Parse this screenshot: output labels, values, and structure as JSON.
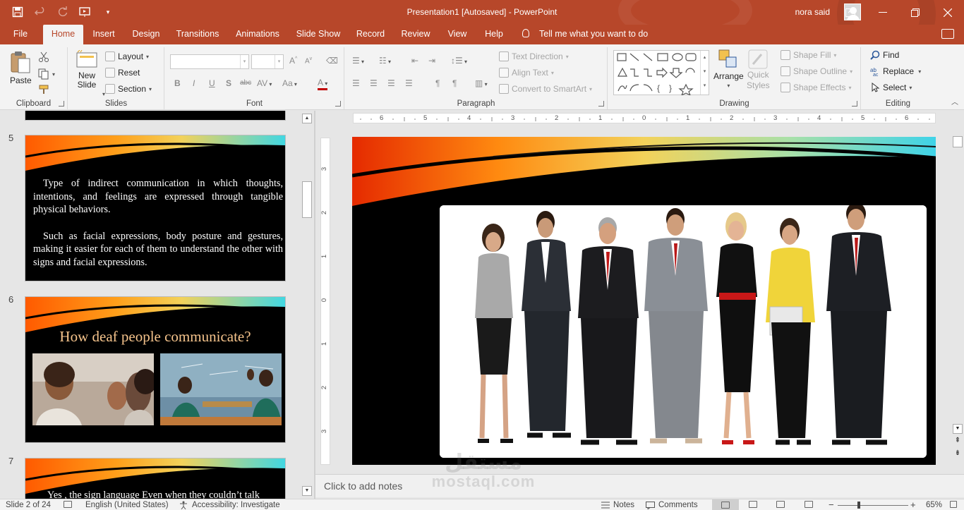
{
  "app": {
    "document_title": "Presentation1 [Autosaved]  -  PowerPoint",
    "user_name": "nora said"
  },
  "quick_access": {
    "icons": [
      "save-icon",
      "undo-icon",
      "redo-icon",
      "present-from-start-icon",
      "customize-icon"
    ]
  },
  "tabs": [
    {
      "label": "File"
    },
    {
      "label": "Home"
    },
    {
      "label": "Insert"
    },
    {
      "label": "Design"
    },
    {
      "label": "Transitions"
    },
    {
      "label": "Animations"
    },
    {
      "label": "Slide Show"
    },
    {
      "label": "Record"
    },
    {
      "label": "Review"
    },
    {
      "label": "View"
    },
    {
      "label": "Help"
    }
  ],
  "active_tab": "Home",
  "tell_me": "Tell me what you want to do",
  "ribbon": {
    "clipboard": {
      "label": "Clipboard",
      "paste": "Paste"
    },
    "slides": {
      "label": "Slides",
      "new_slide_1": "New",
      "new_slide_2": "Slide",
      "layout": "Layout",
      "reset": "Reset",
      "section": "Section"
    },
    "font": {
      "label": "Font",
      "bold": "B",
      "italic": "I",
      "underline": "U",
      "shadow": "S",
      "strike": "abc",
      "spacing": "AV",
      "case": "Aa",
      "color": "A"
    },
    "paragraph": {
      "label": "Paragraph",
      "text_direction": "Text Direction",
      "align_text": "Align Text",
      "convert_smartart": "Convert to SmartArt"
    },
    "drawing": {
      "label": "Drawing",
      "arrange": "Arrange",
      "quick_styles_1": "Quick",
      "quick_styles_2": "Styles",
      "shape_fill": "Shape Fill",
      "shape_outline": "Shape Outline",
      "shape_effects": "Shape Effects"
    },
    "editing": {
      "label": "Editing",
      "find": "Find",
      "replace": "Replace",
      "select": "Select"
    }
  },
  "slides_panel": {
    "slides": [
      {
        "number": "5",
        "paragraphs": [
          "Type of indirect communication in which thoughts, intentions, and feelings are expressed through tangible physical behaviors.",
          "Such as facial expressions, body posture and gestures, making it easier for each of them to understand the other with signs and facial expressions."
        ]
      },
      {
        "number": "6",
        "title": "How deaf people communicate?"
      },
      {
        "number": "7",
        "paragraphs": [
          "Yes , the sign language Even when they couldn’t talk"
        ]
      }
    ]
  },
  "rulers": {
    "horizontal": [
      "6",
      "5",
      "4",
      "3",
      "2",
      "1",
      "0",
      "1",
      "2",
      "3",
      "4",
      "5",
      "6"
    ],
    "vertical": [
      "3",
      "2",
      "1",
      "0",
      "1",
      "2",
      "3"
    ]
  },
  "notes_placeholder": "Click to add notes",
  "watermark": {
    "arabic": "مستقل",
    "latin": "mostaql.com"
  },
  "status": {
    "slide_info": "Slide 2 of 24",
    "language": "English (United States)",
    "accessibility": "Accessibility: Investigate",
    "notes": "Notes",
    "comments": "Comments",
    "zoom": "65%"
  },
  "colors": {
    "accent": "#b7472a",
    "ribbon_bg": "#f3f3f3",
    "title_text": "#f6c48c"
  }
}
